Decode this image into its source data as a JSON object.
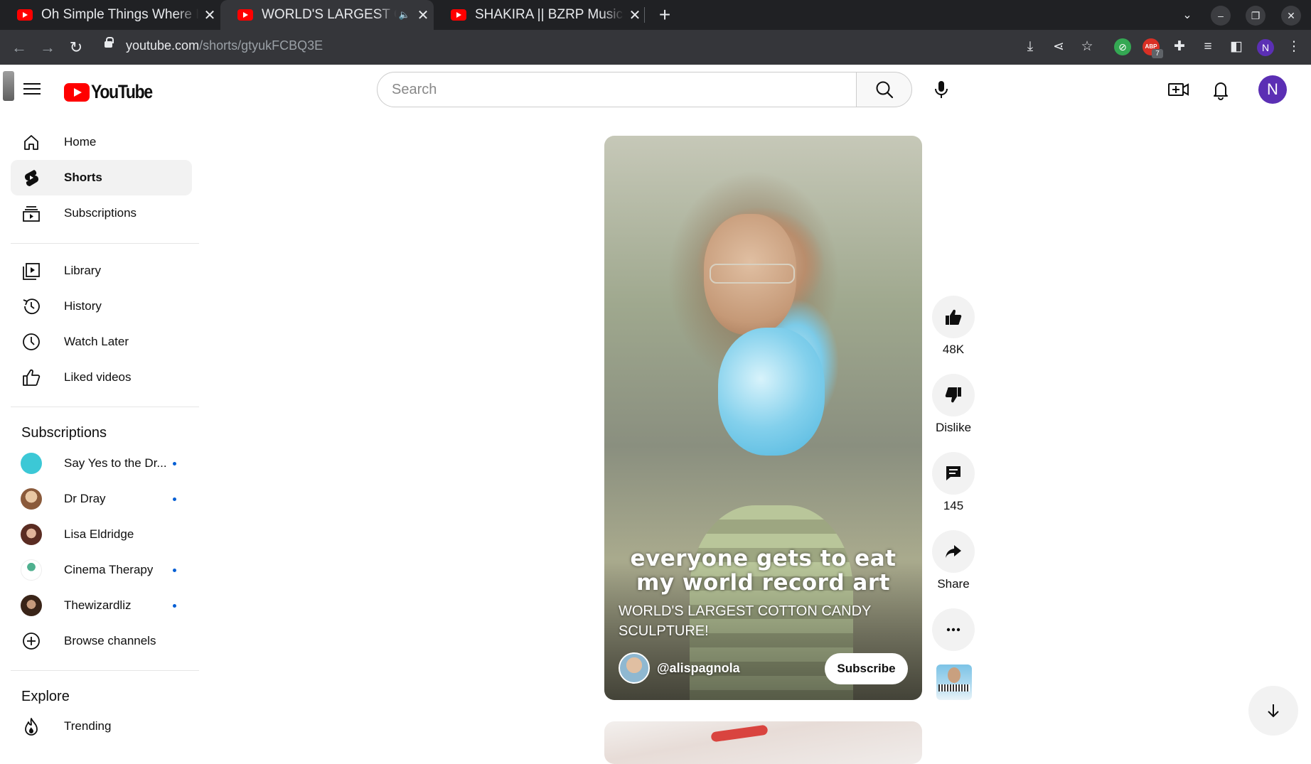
{
  "browser": {
    "tabs": [
      {
        "title": "Oh Simple Things Where I Live",
        "active": false
      },
      {
        "title": "WORLD'S LARGEST COTTON CANDY",
        "active": true,
        "audio": true
      },
      {
        "title": "SHAKIRA || BZRP Music Sessions",
        "active": false
      }
    ],
    "url_host": "youtube.com",
    "url_path": "/shorts/gtyukFCBQ3E",
    "extension_badge": "7",
    "extension_abp_label": "ABP",
    "profile_initial": "N"
  },
  "masthead": {
    "logo_text": "YouTube",
    "search_placeholder": "Search",
    "avatar_initial": "N"
  },
  "sidebar": {
    "main": [
      {
        "label": "Home",
        "icon": "home-icon"
      },
      {
        "label": "Shorts",
        "icon": "shorts-icon",
        "active": true
      },
      {
        "label": "Subscriptions",
        "icon": "subscriptions-icon"
      }
    ],
    "library": [
      {
        "label": "Library",
        "icon": "library-icon"
      },
      {
        "label": "History",
        "icon": "history-icon"
      },
      {
        "label": "Watch Later",
        "icon": "watch-later-icon"
      },
      {
        "label": "Liked videos",
        "icon": "like-icon"
      }
    ],
    "subscriptions_heading": "Subscriptions",
    "subscriptions": [
      {
        "label": "Say Yes to the Dr...",
        "new": true,
        "color": "#3cc8d6"
      },
      {
        "label": "Dr Dray",
        "new": true,
        "color": "#c7926c"
      },
      {
        "label": "Lisa Eldridge",
        "new": false,
        "color": "#7a4a3a"
      },
      {
        "label": "Cinema Therapy",
        "new": true,
        "color": "#2b8ab5"
      },
      {
        "label": "Thewizardliz",
        "new": true,
        "color": "#4a3326"
      }
    ],
    "browse_channels": "Browse channels",
    "explore_heading": "Explore",
    "explore": [
      {
        "label": "Trending",
        "icon": "trending-icon"
      }
    ]
  },
  "short": {
    "overlay_line1": "everyone gets to eat",
    "overlay_line2": "my world record art",
    "title": "WORLD'S LARGEST COTTON CANDY SCULPTURE!",
    "channel": "@alispagnola",
    "subscribe_label": "Subscribe"
  },
  "actions": {
    "like_count": "48K",
    "dislike_label": "Dislike",
    "comment_count": "145",
    "share_label": "Share"
  },
  "colors": {
    "brand_red": "#ff0000",
    "accent_blue": "#065fd4",
    "avatar_purple": "#5b2fb4"
  }
}
